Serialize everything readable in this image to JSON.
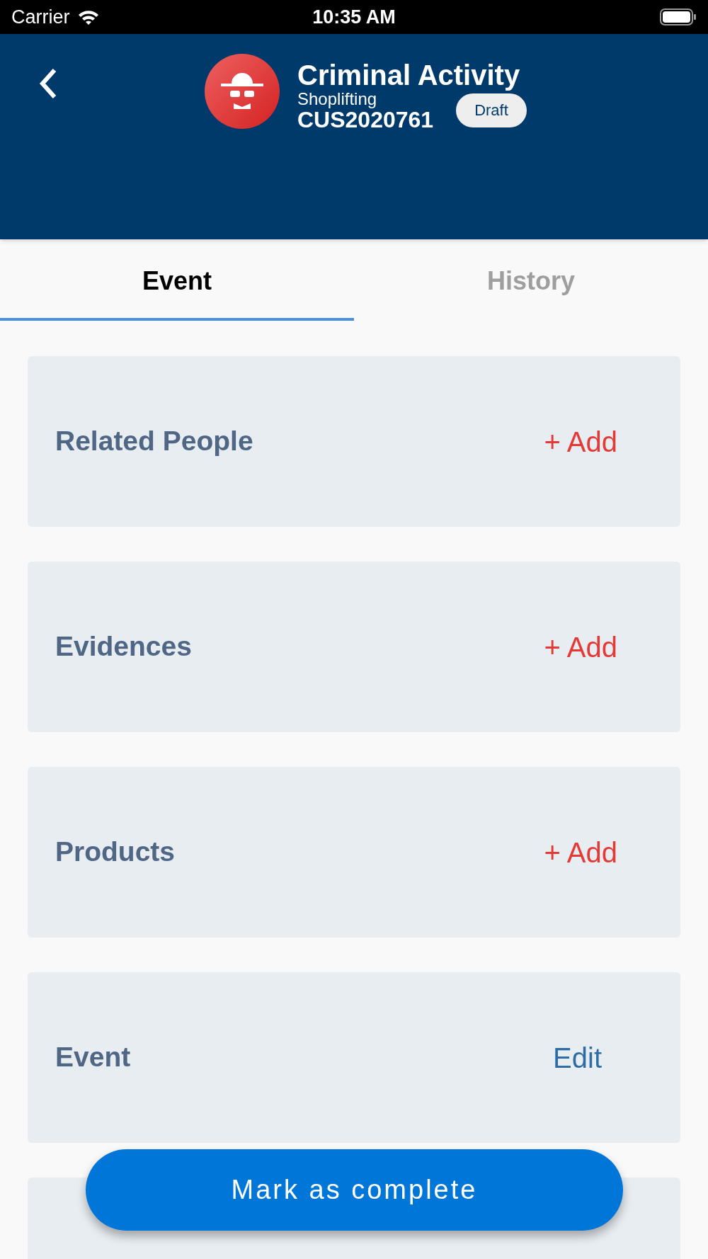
{
  "status_bar": {
    "carrier": "Carrier",
    "time": "10:35 AM"
  },
  "header": {
    "title": "Criminal Activity",
    "subtitle": "Shoplifting",
    "case_number": "CUS2020761",
    "badge": "Draft"
  },
  "tabs": [
    {
      "label": "Event",
      "selected": true
    },
    {
      "label": "History",
      "selected": false
    }
  ],
  "sections": [
    {
      "title": "Related People",
      "kind": "add",
      "action": "+ Add"
    },
    {
      "title": "Evidences",
      "kind": "add",
      "action": "+ Add"
    },
    {
      "title": "Products",
      "kind": "add",
      "action": "+ Add"
    },
    {
      "title": "Event",
      "kind": "edit",
      "action": "Edit"
    },
    {
      "kind": "cut"
    }
  ],
  "primary_button": "Mark as complete"
}
